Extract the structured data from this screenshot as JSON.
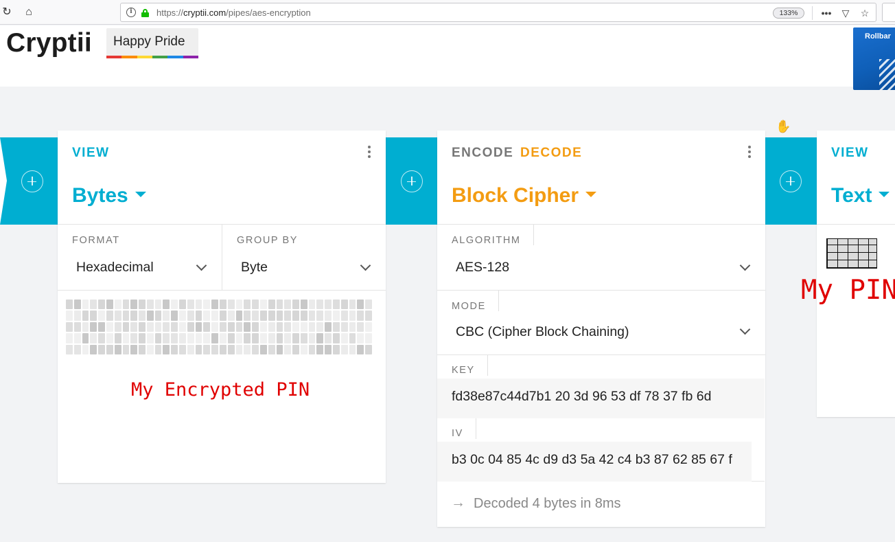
{
  "browser": {
    "url_prefix": "https://",
    "url_host": "cryptii.com",
    "url_path": "/pipes/aes-encryption",
    "zoom": "133%"
  },
  "header": {
    "logo": "Cryptii",
    "pride_label": "Happy Pride",
    "pride_colors": [
      "#e53935",
      "#fb8c00",
      "#fdd835",
      "#43a047",
      "#1e88e5",
      "#8e24aa"
    ],
    "ad_text": "Rollbar"
  },
  "colors": {
    "accent_blue": "#00aed1",
    "decode_orange": "#f39c12",
    "annotation_red": "#e00000"
  },
  "bytes_card": {
    "tab": "VIEW",
    "name": "Bytes",
    "format_label": "FORMAT",
    "format_value": "Hexadecimal",
    "group_label": "GROUP BY",
    "group_value": "Byte",
    "annotation": "My Encrypted PIN"
  },
  "cipher_card": {
    "tab_encode": "ENCODE",
    "tab_decode": "DECODE",
    "name": "Block Cipher",
    "algorithm_label": "ALGORITHM",
    "algorithm_value": "AES-128",
    "mode_label": "MODE",
    "mode_value": "CBC (Cipher Block Chaining)",
    "key_label": "KEY",
    "key_value": "fd38e87c44d7b1 20 3d 96 53 df 78 37 fb 6d",
    "iv_label": "IV",
    "iv_value": "b3 0c 04 85 4c d9 d3 5a 42 c4 b3 87 62 85 67 f",
    "status": "Decoded 4 bytes in 8ms"
  },
  "text_card": {
    "tab": "VIEW",
    "name": "Text",
    "annotation": "My PIN"
  }
}
